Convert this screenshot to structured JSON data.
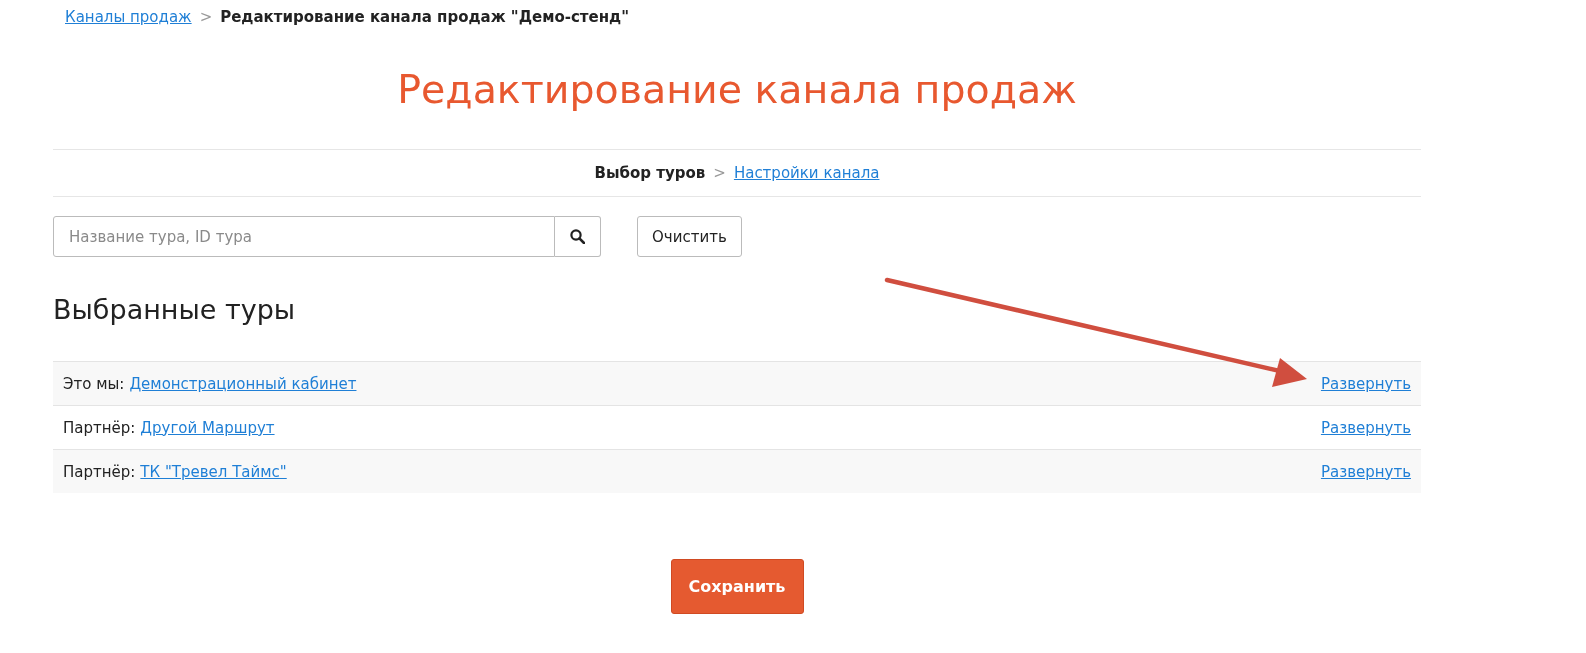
{
  "breadcrumb": {
    "separator": ">",
    "items": [
      {
        "label": "Каналы продаж",
        "kind": "link"
      },
      {
        "label": "Редактирование канала продаж \"Демо-стенд\"",
        "kind": "current"
      }
    ]
  },
  "page_title": "Редактирование канала продаж",
  "steps": {
    "separator": ">",
    "items": [
      {
        "label": "Выбор туров",
        "selected": true
      },
      {
        "label": "Настройки канала",
        "selected": false
      }
    ]
  },
  "search": {
    "placeholder": "Название тура, ID тура"
  },
  "clear_button": "Очистить",
  "selected_tours": {
    "title": "Выбранные туры",
    "rows": [
      {
        "prefix": "Это мы:",
        "name": "Демонстрационный кабинет",
        "action": "Развернуть"
      },
      {
        "prefix": "Партнёр:",
        "name": "Другой Маршрут",
        "action": "Развернуть"
      },
      {
        "prefix": "Партнёр:",
        "name": "ТК \"Тревел Таймс\"",
        "action": "Развернуть"
      }
    ]
  },
  "save_button": "Сохранить"
}
